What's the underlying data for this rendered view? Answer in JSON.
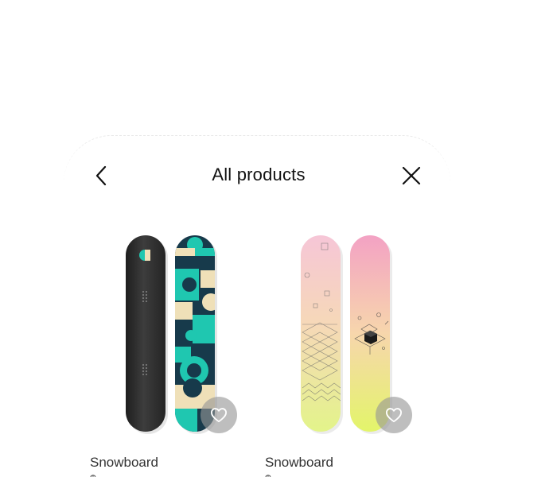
{
  "header": {
    "title": "All products",
    "back_icon": "chevron-left-icon",
    "close_icon": "close-icon"
  },
  "products": [
    {
      "name": "Snowboard",
      "price": "$",
      "favorite_icon": "heart-icon",
      "colors": [
        "#2b2b2b",
        "#173a4b",
        "#1fc7b0",
        "#efe0b8"
      ]
    },
    {
      "name": "Snowboard",
      "price": "$",
      "favorite_icon": "heart-icon",
      "colors": [
        "#f2a9c7",
        "#e9f57b",
        "#cdeea0"
      ]
    }
  ]
}
